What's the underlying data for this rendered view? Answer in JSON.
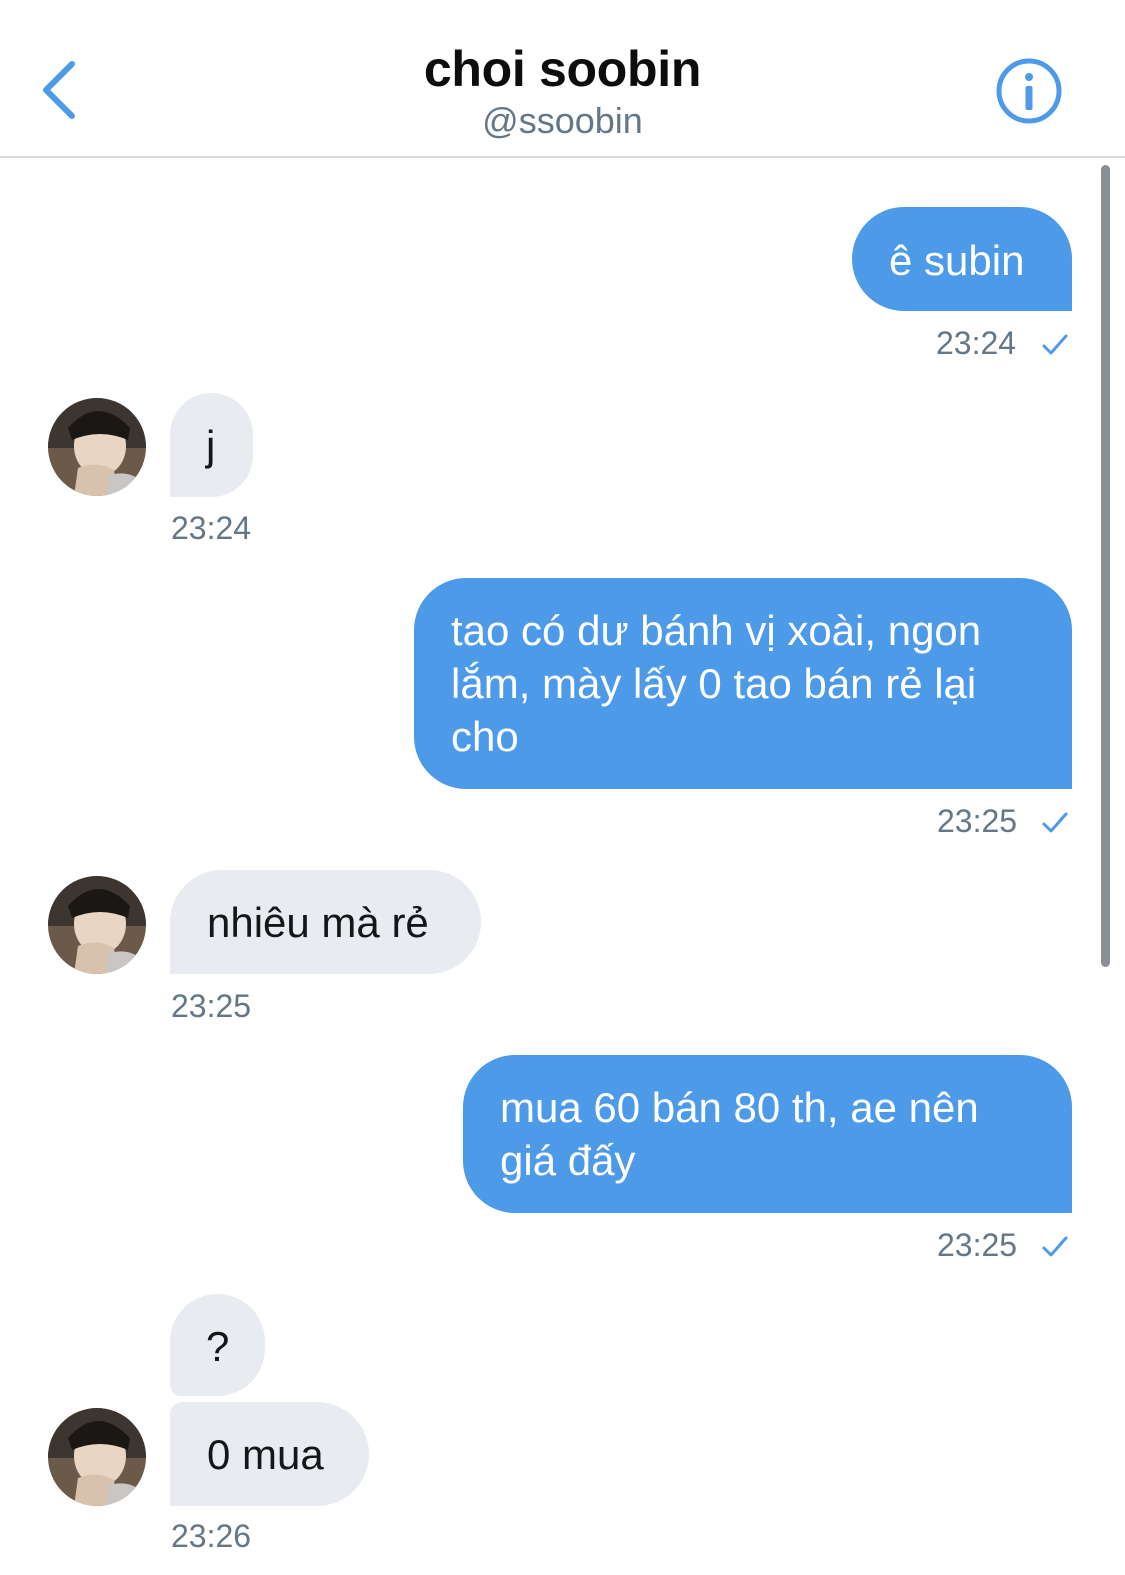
{
  "header": {
    "title": "choi soobin",
    "handle": "@ssoobin",
    "back_icon": "chevron-left-icon",
    "info_icon": "info-icon"
  },
  "colors": {
    "accent": "#4d9ae8",
    "sent_bubble": "#4d9ae8",
    "received_bubble": "#e8ebef",
    "timestamp": "#657786"
  },
  "messages": [
    {
      "direction": "sent",
      "text": "ê subin",
      "time": "23:24",
      "status_icon": "checkmark-icon"
    },
    {
      "direction": "received",
      "text": "j",
      "time": "23:24"
    },
    {
      "direction": "sent",
      "text": "tao có dư bánh vị xoài, ngon lắm, mày lấy 0 tao bán rẻ lại cho",
      "time": "23:25",
      "status_icon": "checkmark-icon"
    },
    {
      "direction": "received",
      "text": "nhiêu mà rẻ",
      "time": "23:25"
    },
    {
      "direction": "sent",
      "text": "mua 60 bán 80 th, ae nên giá đấy",
      "time": "23:25",
      "status_icon": "checkmark-icon"
    },
    {
      "direction": "received",
      "text": "?",
      "time": ""
    },
    {
      "direction": "received",
      "text": "0 mua",
      "time": "23:26"
    }
  ]
}
